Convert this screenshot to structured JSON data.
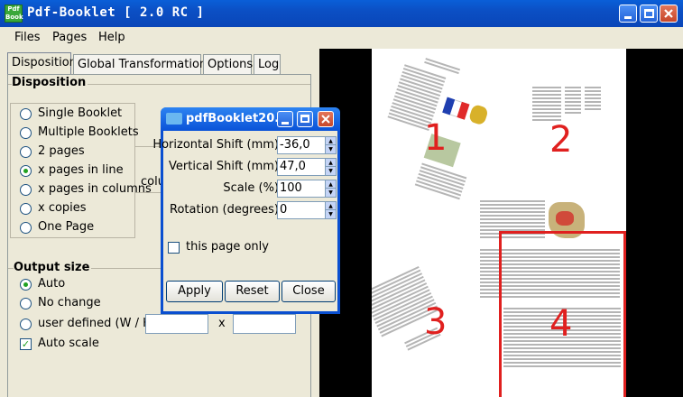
{
  "window": {
    "title": "Pdf-Booklet  [ 2.0 RC ]",
    "icon": "pdf-booklet-app-icon",
    "icon_text": "Pdf Book"
  },
  "menubar": {
    "items": [
      "Files",
      "Pages",
      "Help"
    ]
  },
  "tabs": [
    "Disposition",
    "Global Transformations",
    "Options",
    "Log"
  ],
  "disposition": {
    "title": "Disposition",
    "options": [
      "Single Booklet",
      "Multiple Booklets",
      "2 pages",
      "x pages in line",
      "x pages in columns",
      "x copies",
      "One Page"
    ],
    "selected": "x pages in line",
    "partial_label": "colu"
  },
  "output_size": {
    "title": "Output size",
    "options": [
      "Auto",
      "No change",
      "user defined (W / H)"
    ],
    "selected": "Auto",
    "x_label": "x",
    "auto_scale_label": "Auto scale",
    "auto_scale_checked": true
  },
  "preview": {
    "page_numbers": [
      "1",
      "2",
      "3",
      "4"
    ]
  },
  "dialog": {
    "title": "pdfBooklet20...",
    "fields": [
      {
        "label": "Horizontal Shift (mm)",
        "value": "-36,0"
      },
      {
        "label": "Vertical Shift (mm)",
        "value": "47,0"
      },
      {
        "label": "Scale (%)",
        "value": "100"
      },
      {
        "label": "Rotation (degrees)",
        "value": "0"
      }
    ],
    "this_page_only": "this page only",
    "buttons": {
      "apply": "Apply",
      "reset": "Reset",
      "close": "Close"
    }
  },
  "colors": {
    "titlebar": "#0b4fc4",
    "page_number": "#e0201f",
    "panel": "#ece9d8"
  }
}
